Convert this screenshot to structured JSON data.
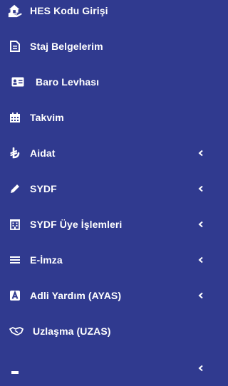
{
  "colors": {
    "background": "#303a8f",
    "text": "#ffffff"
  },
  "menu": {
    "items": [
      {
        "label": "HES Kodu Girişi",
        "icon": "hes-hand-house-icon",
        "has_submenu": false
      },
      {
        "label": "Staj Belgelerim",
        "icon": "document-icon",
        "has_submenu": false
      },
      {
        "label": "Baro Levhası",
        "icon": "id-card-icon",
        "has_submenu": false
      },
      {
        "label": "Takvim",
        "icon": "calendar-icon",
        "has_submenu": false
      },
      {
        "label": "Aidat",
        "icon": "lira-icon",
        "has_submenu": true
      },
      {
        "label": "SYDF",
        "icon": "pencil-icon",
        "has_submenu": true
      },
      {
        "label": "SYDF Üye İşlemleri",
        "icon": "building-icon",
        "has_submenu": true
      },
      {
        "label": "E-İmza",
        "icon": "bars-icon",
        "has_submenu": true
      },
      {
        "label": "Adli Yardım (AYAS)",
        "icon": "letter-a-square-icon",
        "has_submenu": true
      },
      {
        "label": "Uzlaşma (UZAS)",
        "icon": "handshake-icon",
        "has_submenu": false
      },
      {
        "label": "",
        "icon": "partial-item-icon",
        "has_submenu": true
      }
    ]
  }
}
